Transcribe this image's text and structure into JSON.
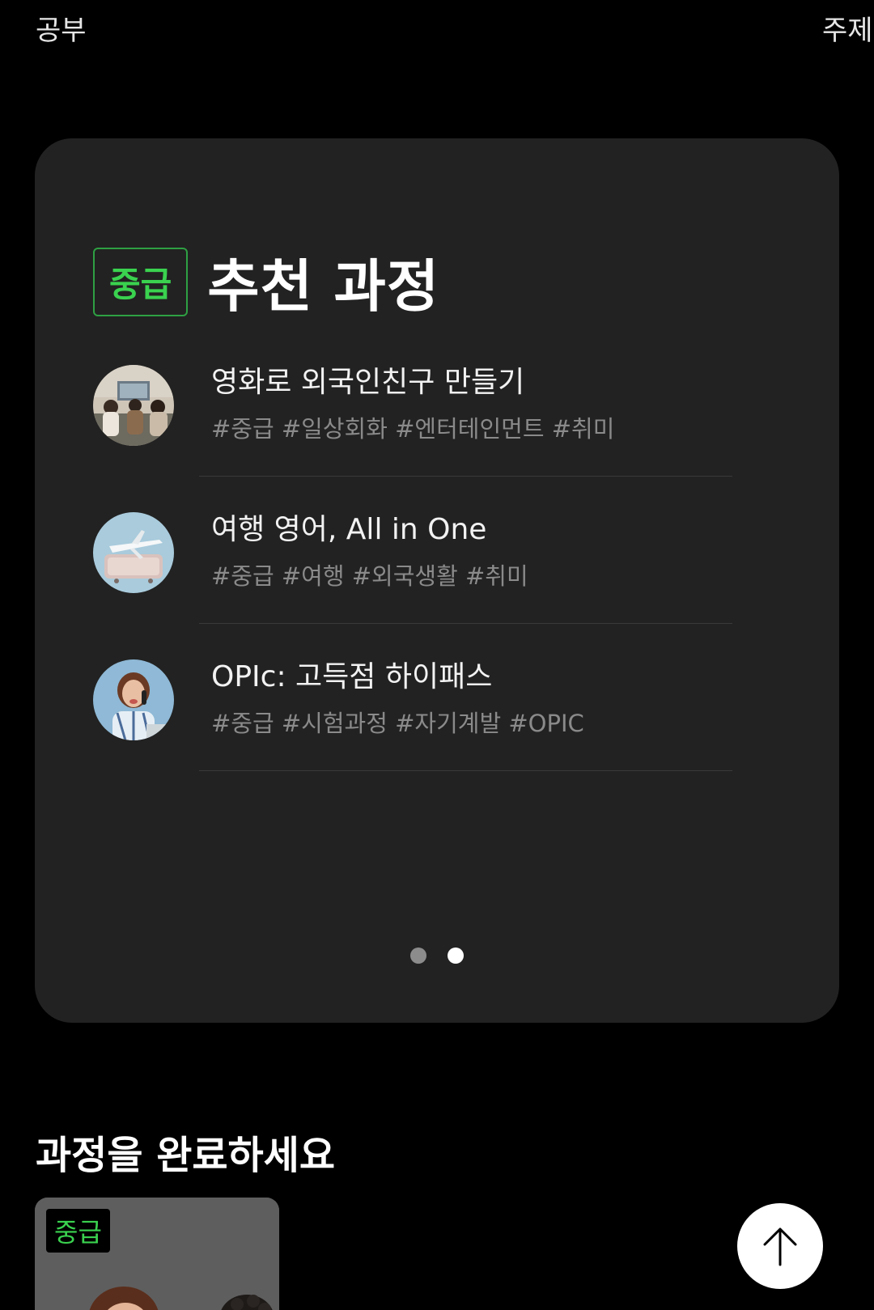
{
  "top_tabs": {
    "left_label": "공부",
    "right_label": "주제"
  },
  "recommend": {
    "level_badge": "중급",
    "title": "추천 과정",
    "courses": [
      {
        "title": "영화로 외국인친구 만들기",
        "tags": "#중급 #일상회화 #엔터테인먼트 #취미",
        "thumb_icon": "movie-friends-photo"
      },
      {
        "title": "여행 영어, All in One",
        "tags": "#중급 #여행 #외국생활 #취미",
        "thumb_icon": "airplane-suitcase-photo"
      },
      {
        "title": "OPIc: 고득점 하이패스",
        "tags": "#중급 #시험과정 #자기계발 #OPIC",
        "thumb_icon": "woman-on-phone-photo"
      }
    ],
    "pager": {
      "total": 2,
      "active_index": 2
    }
  },
  "complete_section": {
    "title": "과정을 완료하세요",
    "card_badge": "중급"
  },
  "scroll_top": {
    "icon": "arrow-up-icon"
  },
  "colors": {
    "background": "#000000",
    "card": "#222222",
    "accent_green": "#3ad24f",
    "tag_gray": "#8a8a8a"
  }
}
